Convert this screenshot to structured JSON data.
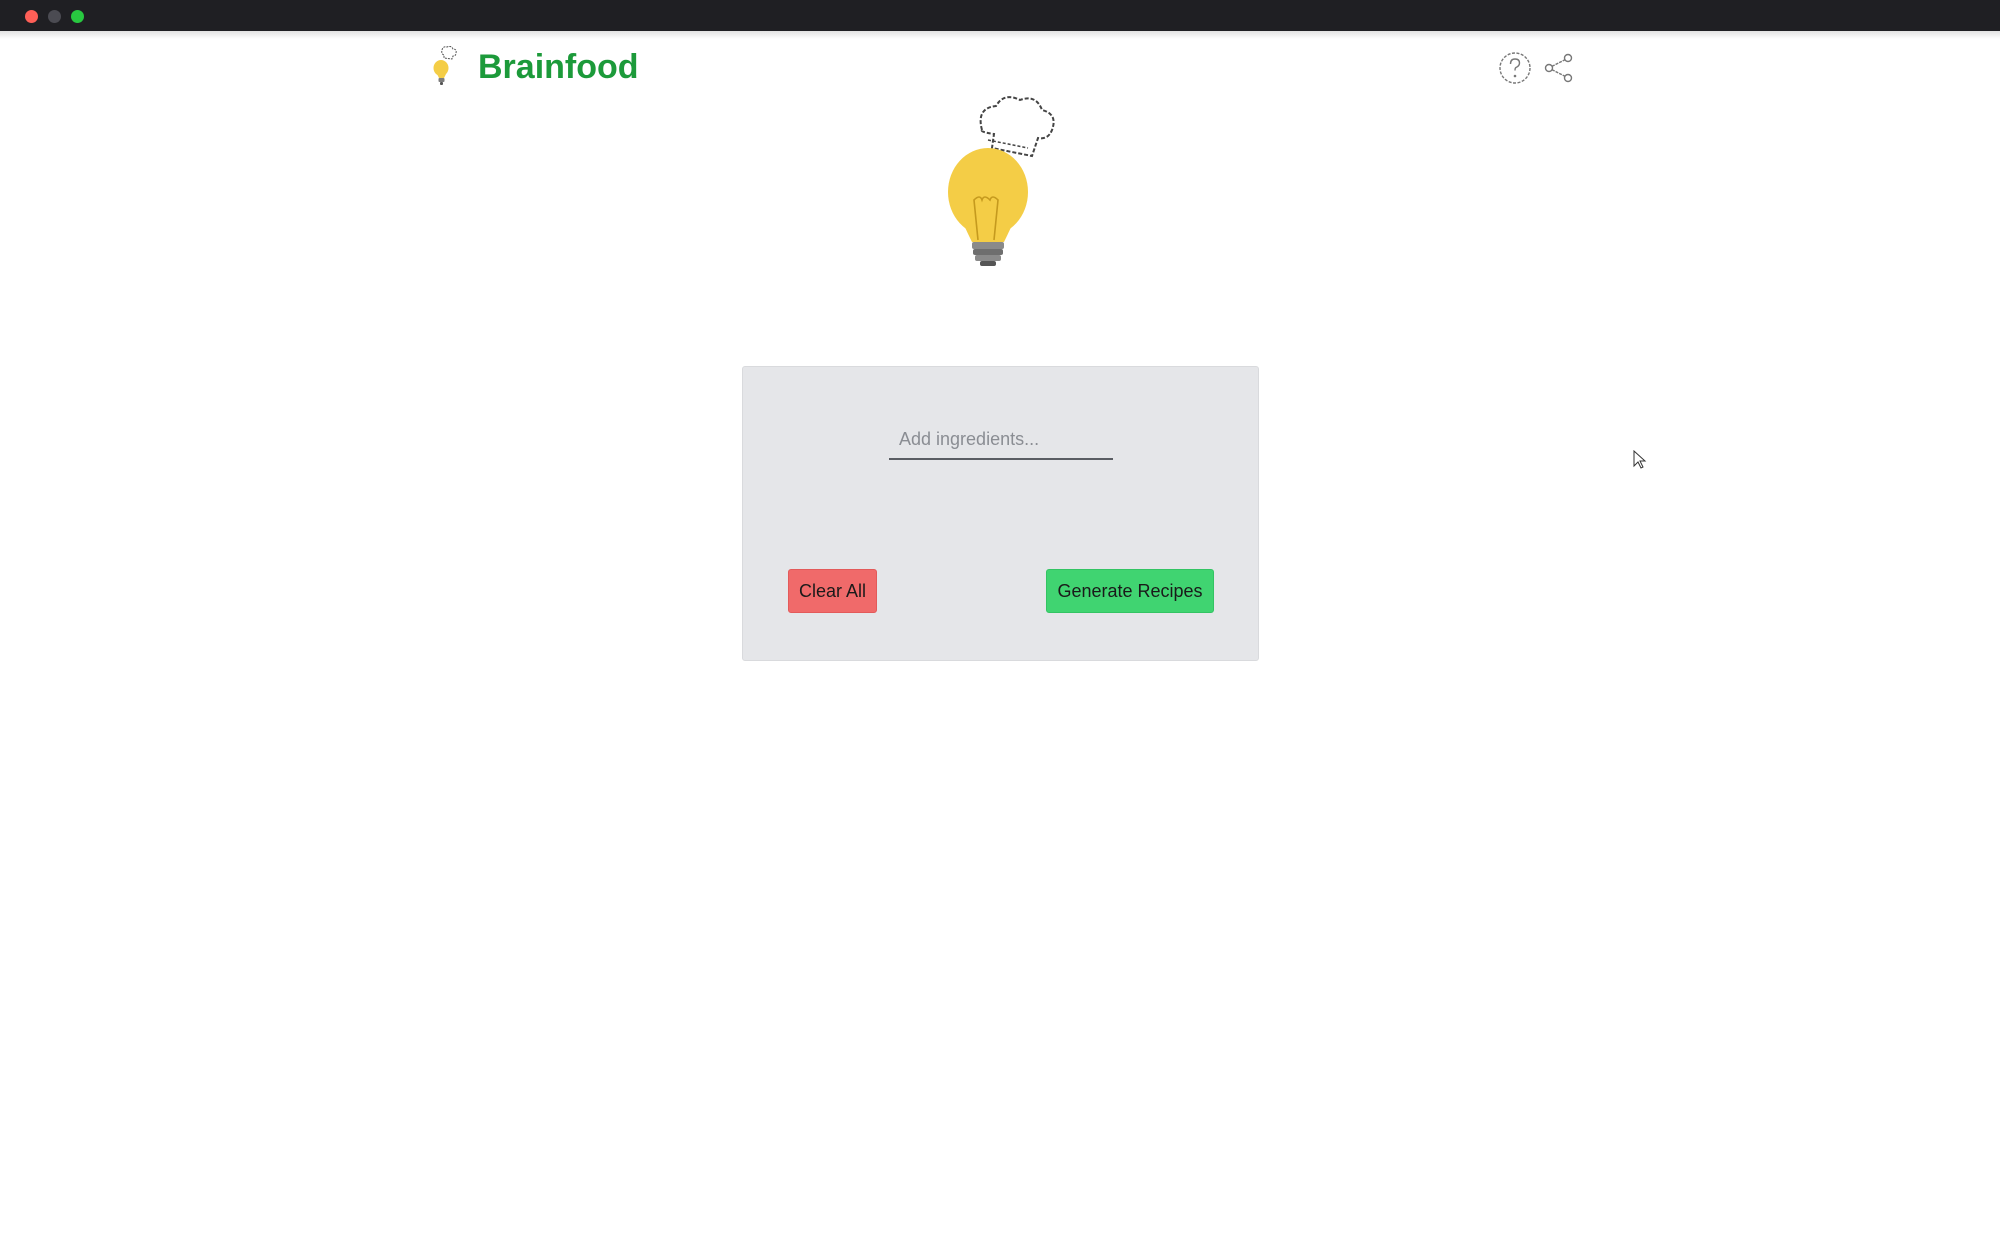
{
  "window": {
    "controls": [
      "close",
      "minimize",
      "maximize"
    ],
    "colors": {
      "titlebar": "#1f1f23",
      "close": "#fe5f57",
      "minimize": "#4b4b52",
      "maximize": "#28c840"
    }
  },
  "header": {
    "brand_title": "Brainfood",
    "brand_color": "#1c9a3a",
    "logo_icon": "lightbulb-chef-hat-icon",
    "icons": [
      "help-icon",
      "share-icon"
    ]
  },
  "hero": {
    "icon": "lightbulb-chef-hat-icon",
    "colors": {
      "bulb": "#f4cd46",
      "base": "#7c7c7c"
    }
  },
  "ingredients_panel": {
    "input_placeholder": "Add ingredients...",
    "input_value": "",
    "clear_button_label": "Clear All",
    "generate_button_label": "Generate Recipes",
    "colors": {
      "panel": "#e5e6e9",
      "clear": "#f06a6a",
      "generate": "#40d471"
    }
  }
}
